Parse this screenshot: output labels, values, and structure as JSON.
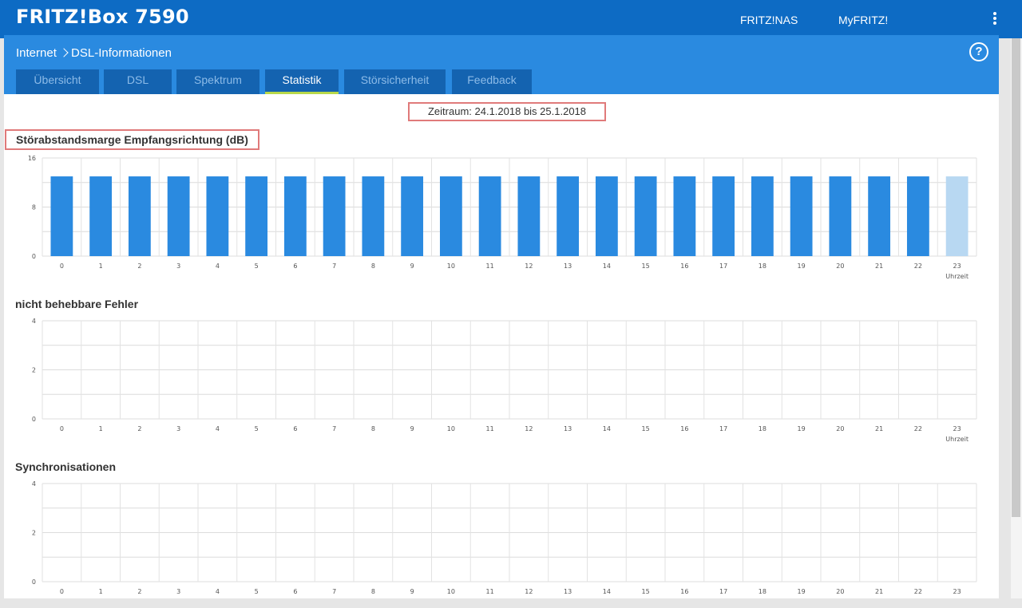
{
  "header": {
    "brand": "FRITZ!Box 7590",
    "links": [
      "FRITZ!NAS",
      "MyFRITZ!"
    ],
    "menu_icon": "kebab-menu-icon",
    "bg_color": "#0d6bc4"
  },
  "breadcrumb": {
    "parent": "Internet",
    "current": "DSL-Informationen",
    "help_icon": "help-icon"
  },
  "tabs": [
    {
      "label": "Übersicht",
      "active": false
    },
    {
      "label": "DSL",
      "active": false
    },
    {
      "label": "Spektrum",
      "active": false
    },
    {
      "label": "Statistik",
      "active": true
    },
    {
      "label": "Störsicherheit",
      "active": false
    },
    {
      "label": "Feedback",
      "active": false
    }
  ],
  "period": "Zeitraum: 24.1.2018 bis 25.1.2018",
  "colors": {
    "bar": "#2a8ae0",
    "bar_partial": "#b8d8f2",
    "highlight": "#e07a7a",
    "tab_active_underline": "#b8d84a"
  },
  "chart_data": [
    {
      "type": "bar",
      "title": "Störabstandsmarge Empfangsrichtung (dB)",
      "xlabel": "Uhrzeit",
      "categories": [
        "0",
        "1",
        "2",
        "3",
        "4",
        "5",
        "6",
        "7",
        "8",
        "9",
        "10",
        "11",
        "12",
        "13",
        "14",
        "15",
        "16",
        "17",
        "18",
        "19",
        "20",
        "21",
        "22",
        "23"
      ],
      "values": [
        13,
        13,
        13,
        13,
        13,
        13,
        13,
        13,
        13,
        13,
        13,
        13,
        13,
        13,
        13,
        13,
        13,
        13,
        13,
        13,
        13,
        13,
        13,
        13
      ],
      "partial_last": true,
      "ylim": [
        0,
        16
      ],
      "yticks": [
        "0",
        "8",
        "16"
      ],
      "grid": true
    },
    {
      "type": "bar",
      "title": "nicht behebbare Fehler",
      "xlabel": "Uhrzeit",
      "categories": [
        "0",
        "1",
        "2",
        "3",
        "4",
        "5",
        "6",
        "7",
        "8",
        "9",
        "10",
        "11",
        "12",
        "13",
        "14",
        "15",
        "16",
        "17",
        "18",
        "19",
        "20",
        "21",
        "22",
        "23"
      ],
      "values": [
        0,
        0,
        0,
        0,
        0,
        0,
        0,
        0,
        0,
        0,
        0,
        0,
        0,
        0,
        0,
        0,
        0,
        0,
        0,
        0,
        0,
        0,
        0,
        0
      ],
      "ylim": [
        0,
        4
      ],
      "yticks": [
        "0",
        "2",
        "4"
      ],
      "grid": true
    },
    {
      "type": "bar",
      "title": "Synchronisationen",
      "xlabel": "",
      "categories": [
        "0",
        "1",
        "2",
        "3",
        "4",
        "5",
        "6",
        "7",
        "8",
        "9",
        "10",
        "11",
        "12",
        "13",
        "14",
        "15",
        "16",
        "17",
        "18",
        "19",
        "20",
        "21",
        "22",
        "23"
      ],
      "values": [
        0,
        0,
        0,
        0,
        0,
        0,
        0,
        0,
        0,
        0,
        0,
        0,
        0,
        0,
        0,
        0,
        0,
        0,
        0,
        0,
        0,
        0,
        0,
        0
      ],
      "ylim": [
        0,
        4
      ],
      "yticks": [
        "0",
        "2",
        "4"
      ],
      "grid": true
    }
  ]
}
